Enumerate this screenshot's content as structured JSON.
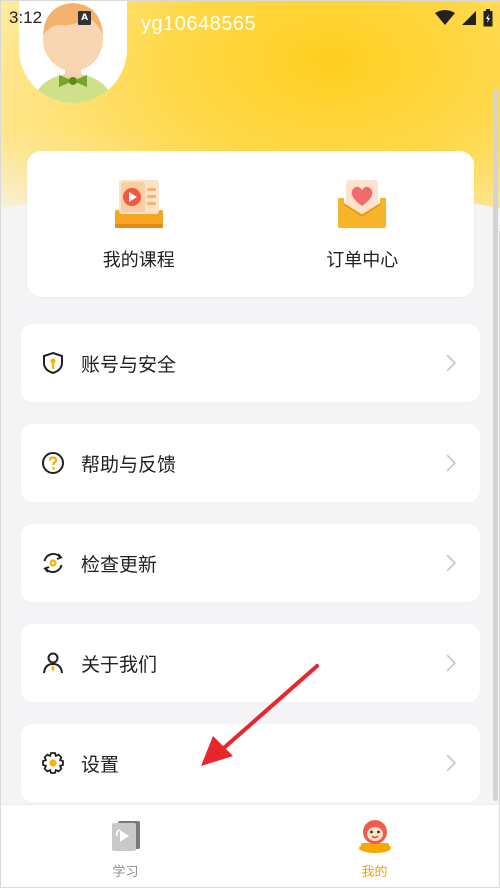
{
  "status_bar": {
    "time": "3:12",
    "notification_badge": "A",
    "icons": [
      "wifi-icon",
      "signal-icon",
      "battery-icon"
    ]
  },
  "profile": {
    "username": "yg10648565"
  },
  "quick_actions": [
    {
      "label": "我的课程",
      "icon": "video-course-icon"
    },
    {
      "label": "订单中心",
      "icon": "heart-envelope-icon"
    }
  ],
  "menu": [
    {
      "label": "账号与安全",
      "icon": "shield-key-icon"
    },
    {
      "label": "帮助与反馈",
      "icon": "question-circle-icon"
    },
    {
      "label": "检查更新",
      "icon": "refresh-gear-icon"
    },
    {
      "label": "关于我们",
      "icon": "person-icon"
    },
    {
      "label": "设置",
      "icon": "gear-icon"
    }
  ],
  "bottom_nav": [
    {
      "label": "学习",
      "icon": "learning-icon",
      "active": false
    },
    {
      "label": "我的",
      "icon": "mascot-icon",
      "active": true
    }
  ],
  "colors": {
    "accent": "#ffc21a",
    "active_tab": "#f5a300",
    "inactive_tab": "#8e8e8e",
    "annotation": "#e8262b"
  }
}
